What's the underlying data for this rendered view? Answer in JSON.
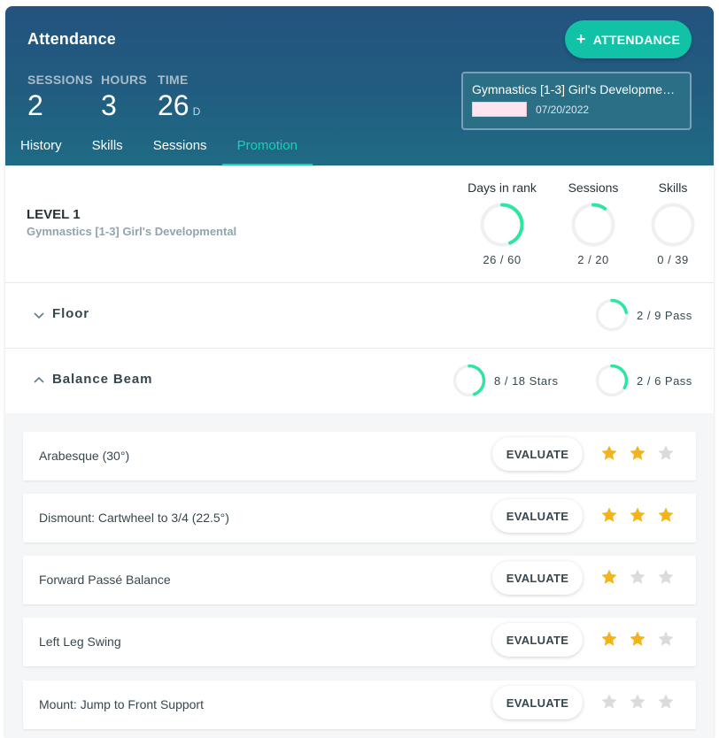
{
  "header": {
    "title": "Attendance",
    "attendance_button": "ATTENDANCE",
    "stats": [
      {
        "label": "SESSIONS",
        "value": "2",
        "unit": ""
      },
      {
        "label": "HOURS",
        "value": "3",
        "unit": ""
      },
      {
        "label": "TIME",
        "value": "26",
        "unit": "D"
      }
    ],
    "rank_card": {
      "program": "Gymnastics [1-3] Girl's Development…",
      "date": "07/20/2022",
      "swatch_color": "#fde4ef"
    },
    "tabs": [
      "History",
      "Skills",
      "Sessions",
      "Promotion"
    ],
    "active_tab": 3
  },
  "level": {
    "title": "LEVEL 1",
    "subtitle": "Gymnastics [1-3] Girl's Developmental",
    "metrics": [
      {
        "label": "Days in rank",
        "value": "26 / 60",
        "fraction": 0.4333
      },
      {
        "label": "Sessions",
        "value": "2 / 20",
        "fraction": 0.1
      },
      {
        "label": "Skills",
        "value": "0 / 39",
        "fraction": 0
      }
    ]
  },
  "sections": [
    {
      "name": "Floor",
      "expanded": false,
      "progress": [
        {
          "text": "2 / 9 Pass",
          "fraction": 0.2222
        }
      ]
    },
    {
      "name": "Balance Beam",
      "expanded": true,
      "progress": [
        {
          "text": "8 / 18 Stars",
          "fraction": 0.4444
        },
        {
          "text": "2 / 6 Pass",
          "fraction": 0.3333
        }
      ]
    }
  ],
  "skills": [
    {
      "name": "Arabesque (30°)",
      "stars": 2
    },
    {
      "name": "Dismount: Cartwheel to 3/4 (22.5°)",
      "stars": 3
    },
    {
      "name": "Forward Passé Balance",
      "stars": 1
    },
    {
      "name": "Left Leg Swing",
      "stars": 2
    },
    {
      "name": "Mount: Jump to Front Support",
      "stars": 0
    }
  ],
  "evaluate_label": "EVALUATE",
  "colors": {
    "accent": "#11c2a6",
    "ring": "#2ee6a0",
    "ring_track": "#eef0f1",
    "star_on": "#f2b31b",
    "star_off": "#d9dcde"
  }
}
